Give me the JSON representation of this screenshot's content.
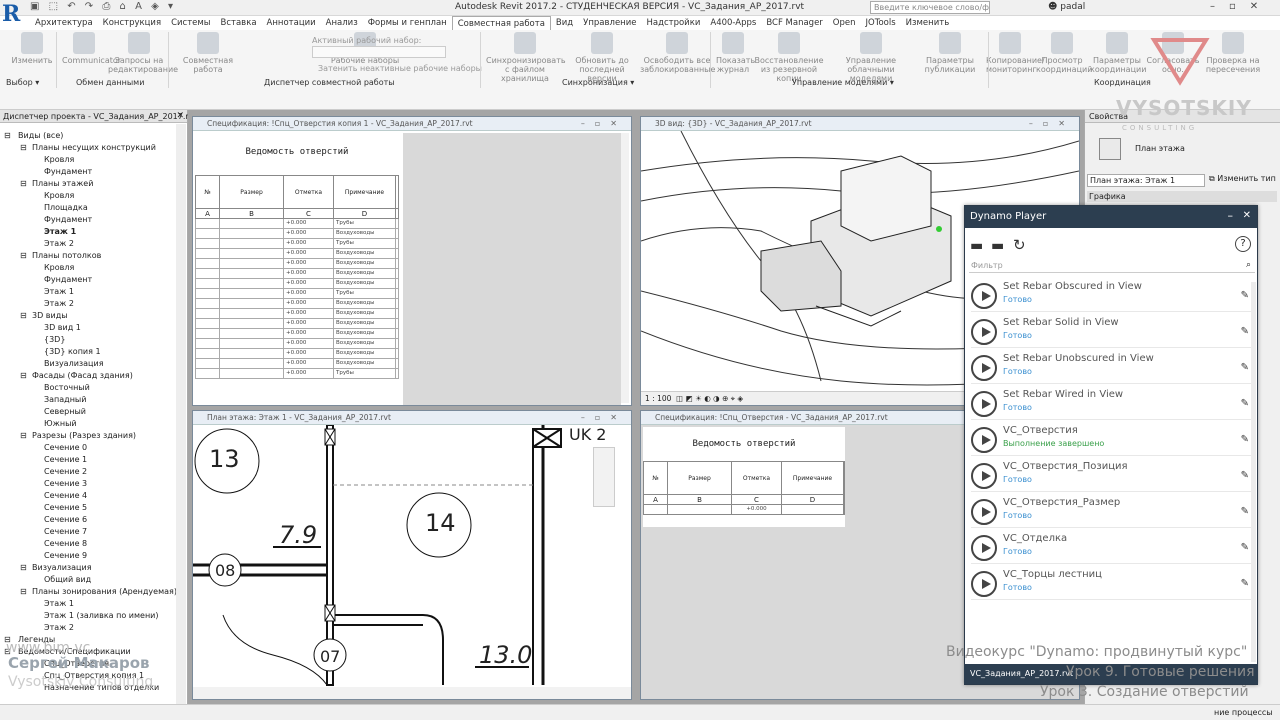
{
  "app": {
    "title": "Autodesk Revit 2017.2 - СТУДЕНЧЕСКАЯ ВЕРСИЯ - VC_Задания_АР_2017.rvt",
    "search_placeholder": "Введите ключевое слово/фразу",
    "user": "padal",
    "logo": "R"
  },
  "tabs": [
    "Архитектура",
    "Конструкция",
    "Системы",
    "Вставка",
    "Аннотации",
    "Анализ",
    "Формы и генплан",
    "Совместная работа",
    "Вид",
    "Управление",
    "Надстройки",
    "A400-Apps",
    "BCF Manager",
    "Open",
    "JOTools",
    "Изменить"
  ],
  "active_tab": "Совместная работа",
  "ribbon": {
    "buttons": [
      "Изменить",
      "Communicator",
      "Запросы на редактирование",
      "Совместная работа",
      "Рабочие наборы",
      "Синхронизировать с файлом хранилища",
      "Обновить до последней версии",
      "Освободить все заблокированные",
      "Показать журнал",
      "Восстановление из резервной копии",
      "Управление облачными моделями",
      "Параметры публикации",
      "Копирование/ мониторинг",
      "Просмотр координаций",
      "Параметры координации",
      "Согласовать осно.",
      "Проверка на пересечения"
    ],
    "active_workset_label": "Активный рабочий набор:",
    "gray_inactive": "Затенить неактивные рабочие наборы",
    "panels": [
      "Выбор ▾",
      "Обмен данными",
      "Диспетчер совместной работы",
      "Синхронизация ▾",
      "Управление моделями ▾",
      "Координация"
    ]
  },
  "browser": {
    "title": "Диспетчер проекта - VC_Задания_АР_2017.rvt",
    "items": [
      {
        "t": "Виды (все)",
        "l": 0
      },
      {
        "t": "Планы несущих конструкций",
        "l": 1
      },
      {
        "t": "Кровля",
        "l": 2
      },
      {
        "t": "Фундамент",
        "l": 2
      },
      {
        "t": "Планы этажей",
        "l": 1
      },
      {
        "t": "Кровля",
        "l": 2
      },
      {
        "t": "Площадка",
        "l": 2
      },
      {
        "t": "Фундамент",
        "l": 2
      },
      {
        "t": "Этаж 1",
        "l": 2,
        "b": true
      },
      {
        "t": "Этаж 2",
        "l": 2
      },
      {
        "t": "Планы потолков",
        "l": 1
      },
      {
        "t": "Кровля",
        "l": 2
      },
      {
        "t": "Фундамент",
        "l": 2
      },
      {
        "t": "Этаж 1",
        "l": 2
      },
      {
        "t": "Этаж 2",
        "l": 2
      },
      {
        "t": "3D виды",
        "l": 1
      },
      {
        "t": "3D вид 1",
        "l": 2
      },
      {
        "t": "{3D}",
        "l": 2
      },
      {
        "t": "{3D} копия 1",
        "l": 2
      },
      {
        "t": "Визуализация",
        "l": 2
      },
      {
        "t": "Фасады (Фасад здания)",
        "l": 1
      },
      {
        "t": "Восточный",
        "l": 2
      },
      {
        "t": "Западный",
        "l": 2
      },
      {
        "t": "Северный",
        "l": 2
      },
      {
        "t": "Южный",
        "l": 2
      },
      {
        "t": "Разрезы (Разрез здания)",
        "l": 1
      },
      {
        "t": "Сечение 0",
        "l": 2
      },
      {
        "t": "Сечение 1",
        "l": 2
      },
      {
        "t": "Сечение 2",
        "l": 2
      },
      {
        "t": "Сечение 3",
        "l": 2
      },
      {
        "t": "Сечение 4",
        "l": 2
      },
      {
        "t": "Сечение 5",
        "l": 2
      },
      {
        "t": "Сечение 6",
        "l": 2
      },
      {
        "t": "Сечение 7",
        "l": 2
      },
      {
        "t": "Сечение 8",
        "l": 2
      },
      {
        "t": "Сечение 9",
        "l": 2
      },
      {
        "t": "Визуализация",
        "l": 1
      },
      {
        "t": "Общий вид",
        "l": 2
      },
      {
        "t": "Планы зонирования (Арендуемая)",
        "l": 1
      },
      {
        "t": "Этаж 1",
        "l": 2
      },
      {
        "t": "Этаж 1 (заливка по имени)",
        "l": 2
      },
      {
        "t": "Этаж 2",
        "l": 2
      },
      {
        "t": "Легенды",
        "l": 0
      },
      {
        "t": "Ведомости/Спецификации",
        "l": 0
      },
      {
        "t": "Спц_Отверстия",
        "l": 2
      },
      {
        "t": "Спц_Отверстия копия 1",
        "l": 2
      },
      {
        "t": "Назначение типов отделки",
        "l": 2
      }
    ]
  },
  "win_sched1": {
    "title": "Спецификация: !Спц_Отверстия копия 1 - VC_Задания_АР_2017.rvt",
    "heading": "Ведомость отверстий",
    "cols": [
      "№",
      "Размер",
      "Отметка",
      "Примечание"
    ],
    "letters": [
      "A",
      "B",
      "C",
      "D"
    ],
    "rows": [
      [
        "",
        "",
        "+0.000",
        "Трубы"
      ],
      [
        "",
        "",
        "+0.000",
        "Воздуховоды"
      ],
      [
        "",
        "",
        "+0.000",
        "Трубы"
      ],
      [
        "",
        "",
        "+0.000",
        "Воздуховоды"
      ],
      [
        "",
        "",
        "+0.000",
        "Воздуховоды"
      ],
      [
        "",
        "",
        "+0.000",
        "Воздуховоды"
      ],
      [
        "",
        "",
        "+0.000",
        "Воздуховоды"
      ],
      [
        "",
        "",
        "+0.000",
        "Трубы"
      ],
      [
        "",
        "",
        "+0.000",
        "Воздуховоды"
      ],
      [
        "",
        "",
        "+0.000",
        "Воздуховоды"
      ],
      [
        "",
        "",
        "+0.000",
        "Воздуховоды"
      ],
      [
        "",
        "",
        "+0.000",
        "Воздуховоды"
      ],
      [
        "",
        "",
        "+0.000",
        "Воздуховоды"
      ],
      [
        "",
        "",
        "+0.000",
        "Воздуховоды"
      ],
      [
        "",
        "",
        "+0.000",
        "Воздуховоды"
      ],
      [
        "",
        "",
        "+0.000",
        "Трубы"
      ]
    ]
  },
  "win_3d": {
    "title": "3D вид: {3D} - VC_Задания_АР_2017.rvt",
    "scale": "1 : 100"
  },
  "win_plan": {
    "title": "План этажа: Этаж 1 - VC_Задания_АР_2017.rvt",
    "tags": [
      "13",
      "14",
      "08",
      "07"
    ],
    "areas": [
      "7.9",
      "13.0"
    ],
    "corner": "UK 2"
  },
  "win_sched2": {
    "title": "Спецификация: !Спц_Отверстия - VC_Задания_АР_2017.rvt",
    "heading": "Ведомость отверстий",
    "cols": [
      "№",
      "Размер",
      "Отметка",
      "Примечание"
    ],
    "letters": [
      "A",
      "B",
      "C",
      "D"
    ],
    "row": [
      "",
      "",
      "+0.000",
      ""
    ]
  },
  "props": {
    "title": "Свойства",
    "type": "План этажа",
    "instance": "План этажа: Этаж 1",
    "edit_type": "Изменить тип",
    "group": "Графика"
  },
  "dynamo": {
    "title": "Dynamo Player",
    "filter": "Фильтр",
    "scripts": [
      {
        "name": "Set Rebar Obscured in View",
        "status": "Готово"
      },
      {
        "name": "Set Rebar Solid in View",
        "status": "Готово"
      },
      {
        "name": "Set Rebar Unobscured in View",
        "status": "Готово"
      },
      {
        "name": "Set Rebar Wired in View",
        "status": "Готово"
      },
      {
        "name": "VC_Отверстия",
        "status": "Выполнение завершено",
        "done": true
      },
      {
        "name": "VC_Отверстия_Позиция",
        "status": "Готово"
      },
      {
        "name": "VC_Отверстия_Размер",
        "status": "Готово"
      },
      {
        "name": "VC_Отделка",
        "status": "Готово"
      },
      {
        "name": "VC_Торцы лестниц",
        "status": "Готово"
      }
    ],
    "footer": "VC_Задания_АР_2017.rvt"
  },
  "overlay": {
    "brand": "VYSOTSKIY",
    "brand_sub": "CONSULTING",
    "author": "Сергей Макаров",
    "site": "www.bim.vc",
    "site2": "Vysotskiy Consulting",
    "course": "Видеокурс \"Dynamo: продвинутый курс\"",
    "lesson": "Урок 9. Готовые решения",
    "lesson_sub": "Урок 3. Создание отверстий"
  },
  "status": {
    "processes": "ние процессы"
  }
}
